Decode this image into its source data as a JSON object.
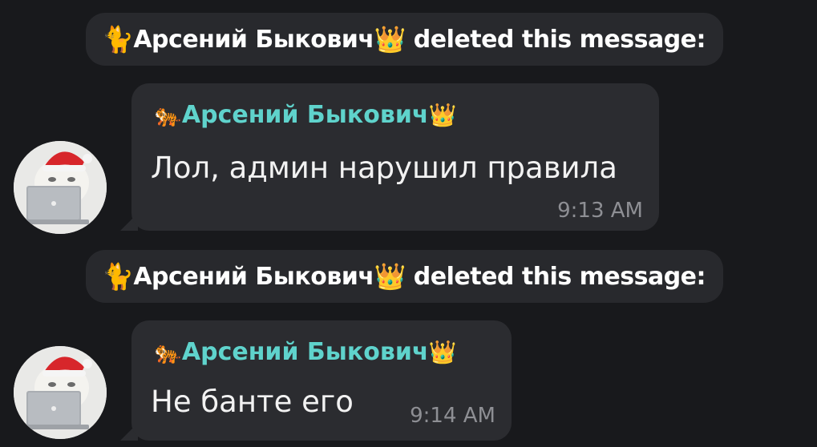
{
  "chat": {
    "service_messages": [
      {
        "actor_emoji": "🐈",
        "actor_name": "Арсений Быкович",
        "actor_badge_emoji": "👑",
        "action": "deleted this message:"
      },
      {
        "actor_emoji": "🐈",
        "actor_name": "Арсений Быкович",
        "actor_badge_emoji": "👑",
        "action": "deleted this message:"
      }
    ],
    "messages": [
      {
        "sender_emoji": "🐅",
        "sender_name": "Арсений Быкович",
        "sender_badge_emoji": "👑",
        "text": "Лол, админ нарушил правила",
        "time": "9:13 AM"
      },
      {
        "sender_emoji": "🐅",
        "sender_name": "Арсений Быкович",
        "sender_badge_emoji": "👑",
        "text": "Не банте его",
        "time": "9:14 AM"
      }
    ]
  },
  "colors": {
    "background": "#18191c",
    "bubble": "#2b2c30",
    "service_pill": "#28292d",
    "sender_name": "#5fd3cc",
    "time": "#8e8f94"
  }
}
